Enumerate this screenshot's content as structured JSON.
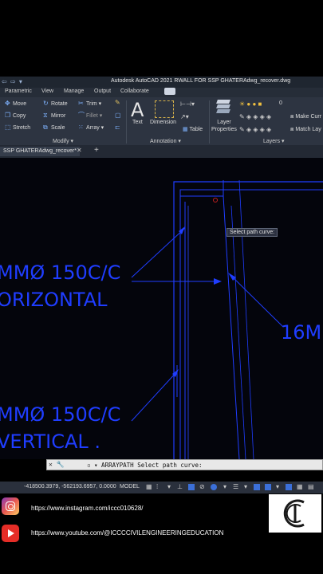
{
  "window": {
    "title": "Autodesk AutoCAD 2021   RWALL FOR SSP GHATERAdwg_recover.dwg",
    "quick_access": "⇦ ⇨ ▾"
  },
  "ribbon_tabs": [
    "Parametric",
    "View",
    "Manage",
    "Output",
    "Collaborate"
  ],
  "modify_panel": {
    "title": "Modify ▾",
    "tools": {
      "move": "Move",
      "rotate": "Rotate",
      "trim": "Trim ▾",
      "copy": "Copy",
      "mirror": "Mirror",
      "fillet": "Fillet ▾",
      "stretch": "Stretch",
      "scale": "Scale",
      "array": "Array ▾"
    }
  },
  "annotation_panel": {
    "title": "Annotation ▾",
    "text": "Text",
    "dimension": "Dimension",
    "table": "Table"
  },
  "layers_panel": {
    "title": "Layers ▾",
    "layer_properties": "Layer\nProperties",
    "make_current": "Make Curr",
    "match_layer": "Match Lay",
    "layer_value": "0"
  },
  "document_tab": {
    "label": "SSP GHATERAdwg_recover*",
    "close": "✕",
    "new_tab": "+"
  },
  "drawing": {
    "texts": {
      "t1": "MMØ 150C/C",
      "t2": "ORIZONTAL",
      "t3": "16M",
      "t4": "MMØ 150C/C",
      "t5": "VERTICAL ."
    },
    "tooltip": "Select path curve:"
  },
  "command_line": {
    "text": "▫ ▾ ARRAYPATH Select path curve:"
  },
  "status_bar": {
    "coordinates": "-418500.3979, -562193.6957, 0.0000",
    "model": "MODEL"
  },
  "footer": {
    "instagram": "https://www.instagram.com/iccc010628/",
    "youtube": "https://www.youtube.com/@ICCCCIVILENGINEERINGEDUCATION"
  },
  "colors": {
    "cad_blue": "#1f3dff",
    "ribbon_bg": "#2d3441",
    "statusbar_bg": "#2a303c"
  }
}
